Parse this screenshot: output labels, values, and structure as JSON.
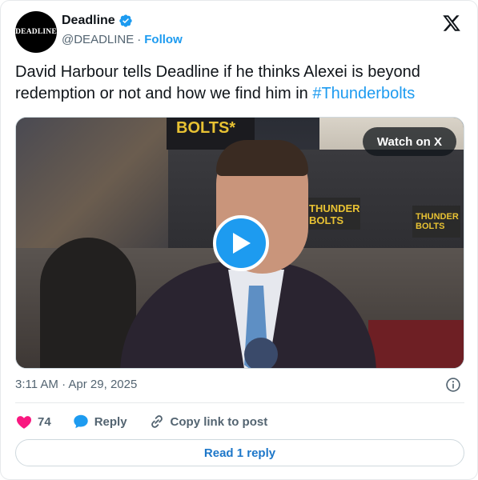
{
  "account": {
    "avatar_text": "DEADLINE",
    "display_name": "Deadline",
    "handle": "@DEADLINE",
    "separator": "·",
    "follow_label": "Follow"
  },
  "tweet": {
    "text": "David Harbour tells Deadline if he thinks Alexei is beyond redemption or not and how we find him in ",
    "hashtag": "#Thunderbolts",
    "timestamp": "3:11 AM · Apr 29, 2025"
  },
  "media": {
    "watch_label": "Watch on X",
    "sign_text": "BOLTS*",
    "poster_text_1": "THUNDER BOLTS",
    "poster_text_2": "THUNDER BOLTS"
  },
  "actions": {
    "likes_count": "74",
    "reply_label": "Reply",
    "copy_link_label": "Copy link to post"
  },
  "read_reply_label": "Read 1 reply",
  "colors": {
    "accent": "#1d9bf0",
    "like": "#f91880",
    "text_secondary": "#536471"
  },
  "icons": [
    "verified-badge-icon",
    "x-logo-icon",
    "play-icon",
    "info-icon",
    "heart-icon",
    "reply-bubble-icon",
    "link-icon"
  ]
}
